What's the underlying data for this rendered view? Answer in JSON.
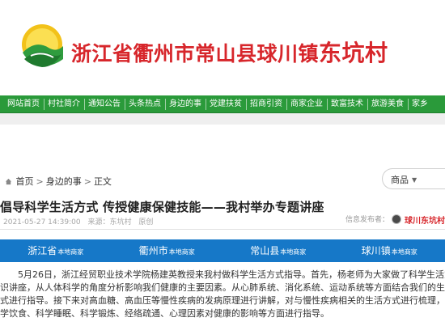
{
  "site": {
    "title_prefix": "浙江省衢州市常山县球川镇",
    "title_village": "东坑村"
  },
  "nav": {
    "items": [
      "网站首页",
      "村社简介",
      "通知公告",
      "头条热点",
      "身边的事",
      "党建扶贫",
      "招商引资",
      "商家企业",
      "致富技术",
      "旅游美食",
      "家乡"
    ]
  },
  "breadcrumb": {
    "items": [
      "首页",
      "身边的事",
      "正文"
    ],
    "separator": ">"
  },
  "search": {
    "selected": "商品"
  },
  "article": {
    "title": "倡导科学生活方式 传授健康保健技能——我村举办专题讲座",
    "date": "2021-05-27 14:39:00",
    "source": "来源：东坑村",
    "category": "原创",
    "source_label": "信息发布者：",
    "publisher": "球川东坑村"
  },
  "channels": [
    {
      "name": "浙江省",
      "suffix": "本地商家"
    },
    {
      "name": "衢州市",
      "suffix": "本地商家"
    },
    {
      "name": "常山县",
      "suffix": "本地商家"
    },
    {
      "name": "球川镇",
      "suffix": "本地商家"
    }
  ],
  "body": {
    "lines": [
      "　　5月26日，浙江经贸职业技术学院杨建英教授来我村做科学生活方式指导。首先，杨老师为大家做了科学生活方式知",
      "识讲座，从人体科学的角度分析影响我们健康的主要因素。从心肺系统、消化系统、运动系统等方面结合我们的生活方",
      "式进行指导。接下来对高血糖、高血压等慢性疾病的发病原理进行讲解，对与慢性疾病相关的生活方式进行梳理，从科",
      "学饮食、科学睡眠、科学锻炼、经络疏通、心理因素对健康的影响等方面进行指导。"
    ]
  },
  "colors": {
    "brand_red": "#d7262b",
    "nav_green": "#2a9a3a",
    "channel_blue": "#1678c8"
  }
}
